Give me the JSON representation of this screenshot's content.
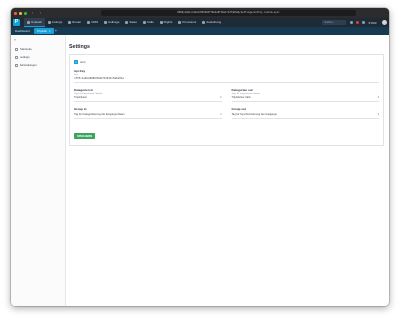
{
  "browser": {
    "url": "8000/admin/9e1dc8031b6f74b2e8f19a7c52f4d3a6/settings/entity-custom-sync",
    "back": "‹",
    "forward": "›"
  },
  "nav": {
    "logo": "P",
    "items": [
      {
        "label": "Unleash"
      },
      {
        "label": "Listings"
      },
      {
        "label": "Router"
      },
      {
        "label": "CRM"
      },
      {
        "label": "Auftrage"
      },
      {
        "label": "Sales"
      },
      {
        "label": "Calls"
      },
      {
        "label": "Flights"
      },
      {
        "label": "Provisions"
      },
      {
        "label": "Ausleihung"
      }
    ],
    "search_placeholder": "Suchen...",
    "user": "STAFF"
  },
  "tabs": {
    "items": [
      "Dashboard",
      "TripAdv"
    ],
    "close": "×",
    "add": "+"
  },
  "sidebar": {
    "toggle": "«",
    "items": [
      {
        "label": "Startseite"
      },
      {
        "label": "settings"
      },
      {
        "label": "Einstellungen"
      }
    ]
  },
  "page": {
    "title": "Settings",
    "active_checkbox": {
      "label": "aktiv",
      "checked": "✓"
    },
    "api_key": {
      "label": "Api Key",
      "hint": "Key",
      "value": "c3f0c1e5ba9860d5a07d2b34c8a6e91e"
    },
    "categories_in": {
      "label": "Kategorien in",
      "hint": "Tags für Eingehende Objekte",
      "value": "TripAdvisor"
    },
    "categories_out": {
      "label": "Kategorien out",
      "hint": "Tags für ausgehende Objekte",
      "value": "TripAdvisor Aktiv"
    },
    "group_in": {
      "label": "Group in",
      "value": "Tag für Kategorisierung der Eingangs-Daten"
    },
    "group_out": {
      "label": "Group out",
      "value": "Tag für Synchronisierung der Ausgangs"
    },
    "save_label": "SPEICHERN"
  }
}
